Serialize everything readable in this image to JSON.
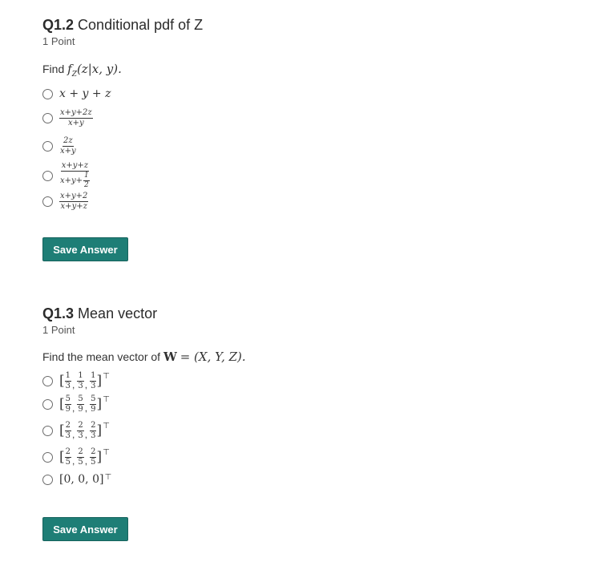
{
  "q12": {
    "number": "Q1.2",
    "title": "Conditional pdf of Z",
    "points": "1 Point",
    "prompt_text": "Find",
    "prompt_math_f": "f",
    "prompt_math_sub": "Z",
    "prompt_math_args": "(z|x, y).",
    "options": [
      {
        "text": "x + y + z"
      },
      {
        "num": "x+y+2z",
        "den": "x+y"
      },
      {
        "num": "2z",
        "den": "x+y"
      },
      {
        "num": "x+y+z",
        "den_main": "x+y+",
        "den_frac_num": "1",
        "den_frac_den": "2"
      },
      {
        "num": "x+y+2",
        "den": "x+y+z"
      }
    ],
    "save_label": "Save Answer"
  },
  "q13": {
    "number": "Q1.3",
    "title": "Mean vector",
    "points": "1 Point",
    "prompt_text": "Find the mean vector of",
    "prompt_math_W": "W",
    "prompt_math_rest": "= (X, Y, Z).",
    "options": [
      {
        "n": [
          "1",
          "1",
          "1"
        ],
        "d": [
          "3",
          "3",
          "3"
        ]
      },
      {
        "n": [
          "5",
          "5",
          "5"
        ],
        "d": [
          "9",
          "9",
          "9"
        ]
      },
      {
        "n": [
          "2",
          "2",
          "2"
        ],
        "d": [
          "3",
          "3",
          "3"
        ]
      },
      {
        "n": [
          "2",
          "2",
          "2"
        ],
        "d": [
          "5",
          "5",
          "5"
        ]
      },
      {
        "text": "[0, 0, 0]"
      }
    ],
    "transpose": "⊤",
    "save_label": "Save Answer"
  }
}
